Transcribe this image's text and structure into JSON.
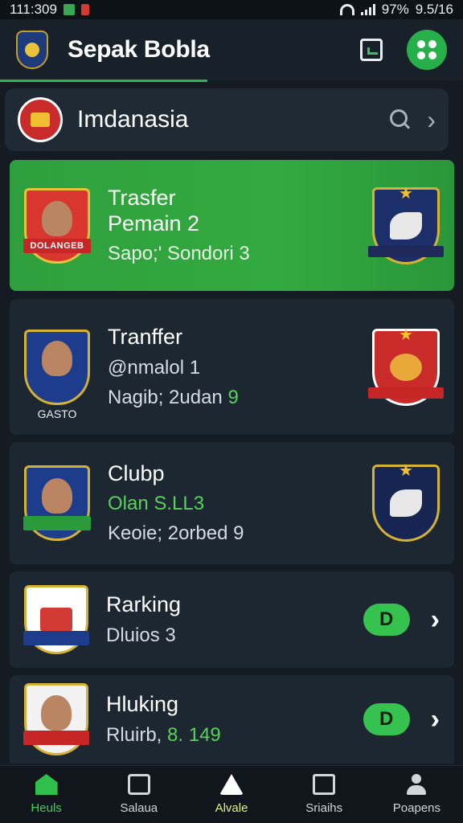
{
  "status_bar": {
    "time_left": "111:309",
    "battery": "97%",
    "time_right": "9.5/16"
  },
  "app_bar": {
    "title": "Sepak Bobla"
  },
  "country_bar": {
    "name": "Imdanasia"
  },
  "cards": [
    {
      "title": "Trasfer",
      "line1": "Pemain 2",
      "line2": "Sapo;' Sondori 3",
      "ribbon": "DOLANGEB",
      "highlight": true
    },
    {
      "title": "Tranffer",
      "line1": "@nmalol 1",
      "line2_prefix": "Nagib; 2udan",
      "line2_number": "9",
      "caption": "GASTO"
    },
    {
      "title": "Clubp",
      "line1": "Olan S.LL3",
      "line2": "Keoie; 2orbed 9"
    },
    {
      "title": "Rarking",
      "line1": "Dluios 3",
      "badge": "D"
    },
    {
      "title": "Hluking",
      "line1_prefix": "Rluirb,",
      "line1_number": "8. 149",
      "badge": "D"
    }
  ],
  "bottom_nav": [
    {
      "label": "Heuls",
      "icon": "home-icon",
      "active": true
    },
    {
      "label": "Salaua",
      "icon": "stats-icon",
      "active": false
    },
    {
      "label": "Alvale",
      "icon": "triangle-icon",
      "active": false
    },
    {
      "label": "Sriaihs",
      "icon": "grid-icon",
      "active": false
    },
    {
      "label": "Poapens",
      "icon": "person-icon",
      "active": false
    }
  ],
  "colors": {
    "background": "#141b22",
    "accent_green": "#33aa3f",
    "card": "#1d2731"
  }
}
